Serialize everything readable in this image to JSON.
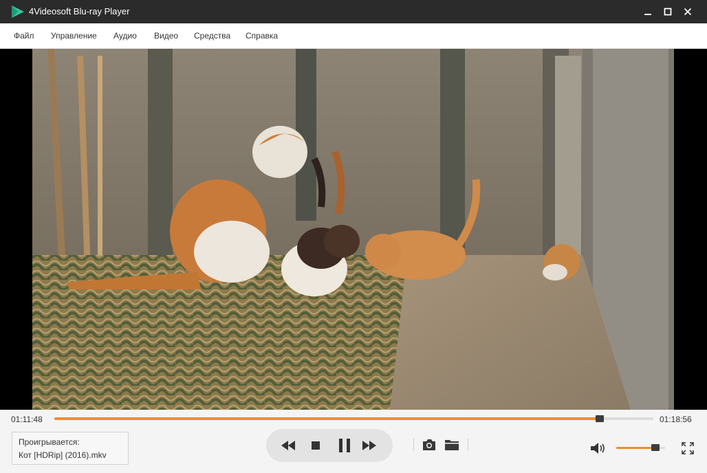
{
  "window": {
    "title": "4Videosoft Blu-ray Player",
    "logo_icon": "play-logo-icon",
    "accent": "#f08c2e",
    "logo_color": "#3bc39a"
  },
  "menu": [
    "Файл",
    "Управление",
    "Аудио",
    "Видео",
    "Средства",
    "Справка"
  ],
  "player": {
    "current_time": "01:11:48",
    "total_time": "01:18:56",
    "progress_fraction": 0.91,
    "volume_fraction": 0.8,
    "now_playing_label": "Проигрывается:",
    "now_playing_file": "Кот [HDRip] (2016).mkv",
    "state": "playing"
  },
  "icons": {
    "rewind": "rewind-icon",
    "stop": "stop-icon",
    "pause": "pause-icon",
    "forward": "fast-forward-icon",
    "snapshot": "camera-icon",
    "open_folder": "folder-icon",
    "volume": "volume-icon",
    "fullscreen": "fullscreen-icon"
  }
}
